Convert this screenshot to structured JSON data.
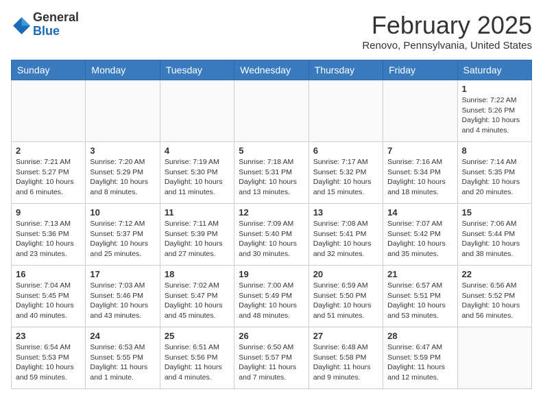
{
  "header": {
    "logo_general": "General",
    "logo_blue": "Blue",
    "month_title": "February 2025",
    "location": "Renovo, Pennsylvania, United States"
  },
  "days_of_week": [
    "Sunday",
    "Monday",
    "Tuesday",
    "Wednesday",
    "Thursday",
    "Friday",
    "Saturday"
  ],
  "weeks": [
    [
      {
        "day": "",
        "info": ""
      },
      {
        "day": "",
        "info": ""
      },
      {
        "day": "",
        "info": ""
      },
      {
        "day": "",
        "info": ""
      },
      {
        "day": "",
        "info": ""
      },
      {
        "day": "",
        "info": ""
      },
      {
        "day": "1",
        "info": "Sunrise: 7:22 AM\nSunset: 5:26 PM\nDaylight: 10 hours\nand 4 minutes."
      }
    ],
    [
      {
        "day": "2",
        "info": "Sunrise: 7:21 AM\nSunset: 5:27 PM\nDaylight: 10 hours\nand 6 minutes."
      },
      {
        "day": "3",
        "info": "Sunrise: 7:20 AM\nSunset: 5:29 PM\nDaylight: 10 hours\nand 8 minutes."
      },
      {
        "day": "4",
        "info": "Sunrise: 7:19 AM\nSunset: 5:30 PM\nDaylight: 10 hours\nand 11 minutes."
      },
      {
        "day": "5",
        "info": "Sunrise: 7:18 AM\nSunset: 5:31 PM\nDaylight: 10 hours\nand 13 minutes."
      },
      {
        "day": "6",
        "info": "Sunrise: 7:17 AM\nSunset: 5:32 PM\nDaylight: 10 hours\nand 15 minutes."
      },
      {
        "day": "7",
        "info": "Sunrise: 7:16 AM\nSunset: 5:34 PM\nDaylight: 10 hours\nand 18 minutes."
      },
      {
        "day": "8",
        "info": "Sunrise: 7:14 AM\nSunset: 5:35 PM\nDaylight: 10 hours\nand 20 minutes."
      }
    ],
    [
      {
        "day": "9",
        "info": "Sunrise: 7:13 AM\nSunset: 5:36 PM\nDaylight: 10 hours\nand 23 minutes."
      },
      {
        "day": "10",
        "info": "Sunrise: 7:12 AM\nSunset: 5:37 PM\nDaylight: 10 hours\nand 25 minutes."
      },
      {
        "day": "11",
        "info": "Sunrise: 7:11 AM\nSunset: 5:39 PM\nDaylight: 10 hours\nand 27 minutes."
      },
      {
        "day": "12",
        "info": "Sunrise: 7:09 AM\nSunset: 5:40 PM\nDaylight: 10 hours\nand 30 minutes."
      },
      {
        "day": "13",
        "info": "Sunrise: 7:08 AM\nSunset: 5:41 PM\nDaylight: 10 hours\nand 32 minutes."
      },
      {
        "day": "14",
        "info": "Sunrise: 7:07 AM\nSunset: 5:42 PM\nDaylight: 10 hours\nand 35 minutes."
      },
      {
        "day": "15",
        "info": "Sunrise: 7:06 AM\nSunset: 5:44 PM\nDaylight: 10 hours\nand 38 minutes."
      }
    ],
    [
      {
        "day": "16",
        "info": "Sunrise: 7:04 AM\nSunset: 5:45 PM\nDaylight: 10 hours\nand 40 minutes."
      },
      {
        "day": "17",
        "info": "Sunrise: 7:03 AM\nSunset: 5:46 PM\nDaylight: 10 hours\nand 43 minutes."
      },
      {
        "day": "18",
        "info": "Sunrise: 7:02 AM\nSunset: 5:47 PM\nDaylight: 10 hours\nand 45 minutes."
      },
      {
        "day": "19",
        "info": "Sunrise: 7:00 AM\nSunset: 5:49 PM\nDaylight: 10 hours\nand 48 minutes."
      },
      {
        "day": "20",
        "info": "Sunrise: 6:59 AM\nSunset: 5:50 PM\nDaylight: 10 hours\nand 51 minutes."
      },
      {
        "day": "21",
        "info": "Sunrise: 6:57 AM\nSunset: 5:51 PM\nDaylight: 10 hours\nand 53 minutes."
      },
      {
        "day": "22",
        "info": "Sunrise: 6:56 AM\nSunset: 5:52 PM\nDaylight: 10 hours\nand 56 minutes."
      }
    ],
    [
      {
        "day": "23",
        "info": "Sunrise: 6:54 AM\nSunset: 5:53 PM\nDaylight: 10 hours\nand 59 minutes."
      },
      {
        "day": "24",
        "info": "Sunrise: 6:53 AM\nSunset: 5:55 PM\nDaylight: 11 hours\nand 1 minute."
      },
      {
        "day": "25",
        "info": "Sunrise: 6:51 AM\nSunset: 5:56 PM\nDaylight: 11 hours\nand 4 minutes."
      },
      {
        "day": "26",
        "info": "Sunrise: 6:50 AM\nSunset: 5:57 PM\nDaylight: 11 hours\nand 7 minutes."
      },
      {
        "day": "27",
        "info": "Sunrise: 6:48 AM\nSunset: 5:58 PM\nDaylight: 11 hours\nand 9 minutes."
      },
      {
        "day": "28",
        "info": "Sunrise: 6:47 AM\nSunset: 5:59 PM\nDaylight: 11 hours\nand 12 minutes."
      },
      {
        "day": "",
        "info": ""
      }
    ]
  ]
}
